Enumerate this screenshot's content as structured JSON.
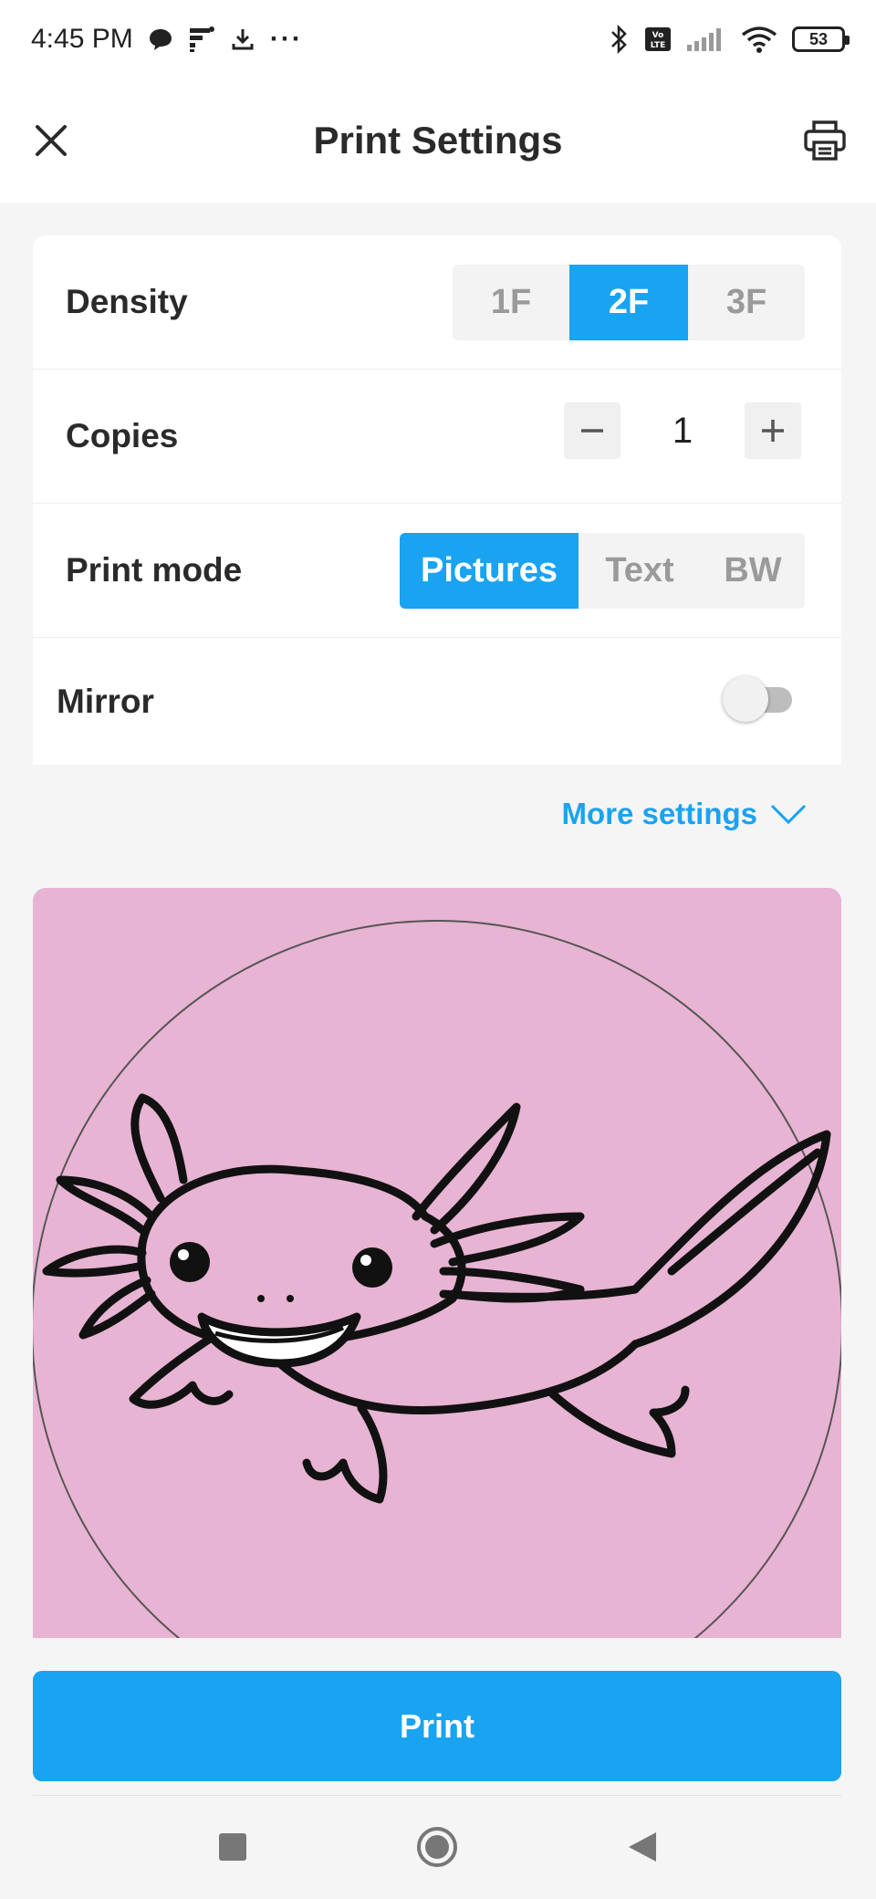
{
  "status_bar": {
    "time": "4:45 PM",
    "battery": "53",
    "more": "···",
    "icons": [
      "chat-bubble-icon",
      "grid-app-icon",
      "download-icon",
      "bluetooth-icon",
      "volte-icon",
      "signal-icon",
      "wifi-icon",
      "battery-icon"
    ]
  },
  "header": {
    "title": "Print Settings",
    "close_icon": "close-icon",
    "printer_icon": "printer-icon"
  },
  "settings": {
    "density": {
      "label": "Density",
      "options": [
        "1F",
        "2F",
        "3F"
      ],
      "selected": "2F"
    },
    "copies": {
      "label": "Copies",
      "value": "1"
    },
    "print_mode": {
      "label": "Print mode",
      "options": [
        "Pictures",
        "Text",
        "BW"
      ],
      "selected": "Pictures"
    },
    "mirror": {
      "label": "Mirror",
      "enabled": false
    }
  },
  "more_settings": {
    "label": "More settings"
  },
  "print_button": {
    "label": "Print"
  },
  "colors": {
    "accent": "#1aa3f0",
    "preview_background": "#e8b4d3"
  }
}
